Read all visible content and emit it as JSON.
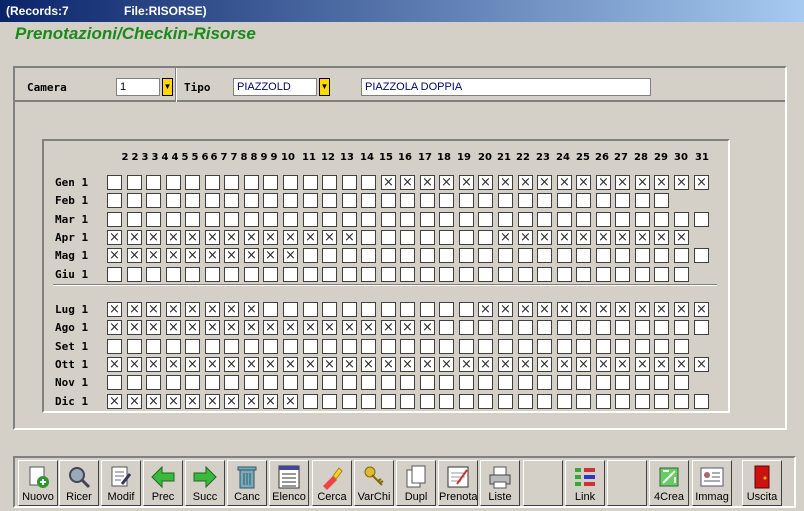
{
  "window": {
    "records": "(Records:7",
    "file": "File:RISORSE)"
  },
  "heading": "Prenotazioni/Checkin-Risorse",
  "form": {
    "camera_label": "Camera",
    "camera_value": "1",
    "tipo_label": "Tipo",
    "tipo_value": "PIAZZOLD",
    "tipo_desc": "PIAZZOLA DOPPIA"
  },
  "calendar": {
    "days": [
      "2",
      "2",
      "3",
      "3",
      "4",
      "4",
      "5",
      "5",
      "6",
      "6",
      "7",
      "7",
      "8",
      "8",
      "9",
      "9",
      "10",
      "11",
      "12",
      "13",
      "14",
      "15",
      "16",
      "17",
      "18",
      "19",
      "20",
      "21",
      "22",
      "23",
      "24",
      "25",
      "26",
      "27",
      "28",
      "29",
      "30",
      "31"
    ],
    "months": [
      {
        "label": "Gen 1",
        "cells": "0000000000000011111111111111111",
        "len": 31
      },
      {
        "label": "Feb 1",
        "cells": "0000000000000000000000000000000",
        "len": 29
      },
      {
        "label": "Mar 1",
        "cells": "0000000000000000000000000000000",
        "len": 31
      },
      {
        "label": "Apr 1",
        "cells": "1111111111111000000011111111111",
        "len": 30
      },
      {
        "label": "Mag 1",
        "cells": "1111111111000000000000000000000",
        "len": 31
      },
      {
        "label": "Giu 1",
        "cells": "0000000000000000000000000000000",
        "len": 30
      },
      {
        "label": "Lug 1",
        "cells": "1111111100000000000111111111111",
        "len": 31
      },
      {
        "label": "Ago 1",
        "cells": "1111111111111111100000000000000",
        "len": 31
      },
      {
        "label": "Set 1",
        "cells": "0000000000000000000000000000000",
        "len": 30
      },
      {
        "label": "Ott 1",
        "cells": "1111111111111111111111111111111",
        "len": 31
      },
      {
        "label": "Nov 1",
        "cells": "0000000000000000000000000000000",
        "len": 30
      },
      {
        "label": "Dic 1",
        "cells": "1111111111000000000000000000000",
        "len": 31
      }
    ]
  },
  "toolbar": [
    {
      "label": "Nuovo",
      "icon": "new-icon"
    },
    {
      "label": "Ricer",
      "icon": "search-icon"
    },
    {
      "label": "Modif",
      "icon": "edit-icon"
    },
    {
      "label": "Prec",
      "icon": "arrow-left-icon"
    },
    {
      "label": "Succ",
      "icon": "arrow-right-icon"
    },
    {
      "label": "Canc",
      "icon": "trash-icon"
    },
    {
      "label": "Elenco",
      "icon": "list-icon"
    },
    {
      "label": "Cerca",
      "icon": "find-icon"
    },
    {
      "label": "VarChi",
      "icon": "keys-icon"
    },
    {
      "label": "Dupl",
      "icon": "duplicate-icon"
    },
    {
      "label": "Prenota",
      "icon": "booking-icon"
    },
    {
      "label": "Liste",
      "icon": "printer-icon"
    },
    {
      "label": "",
      "icon": ""
    },
    {
      "label": "Link",
      "icon": "link-icon"
    },
    {
      "label": "",
      "icon": ""
    },
    {
      "label": "4Crea",
      "icon": "create-icon"
    },
    {
      "label": "Immag",
      "icon": "image-icon"
    },
    {
      "label": "Uscita",
      "icon": "exit-door-icon"
    }
  ]
}
